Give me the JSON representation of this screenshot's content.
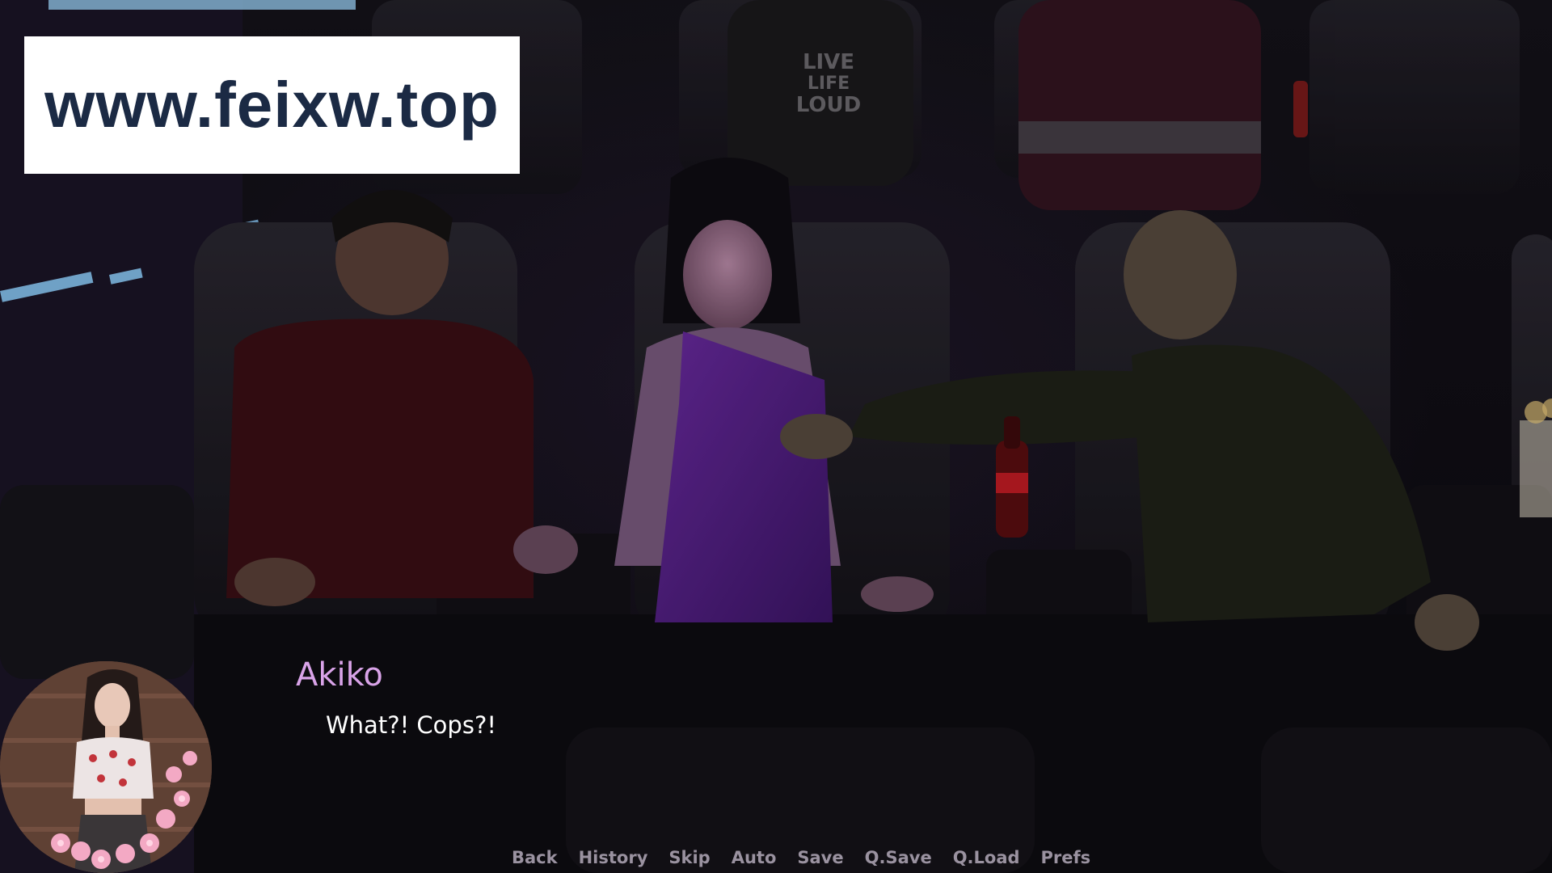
{
  "watermark": {
    "text": "www.feixw.top"
  },
  "dialogue": {
    "speaker": "Akiko",
    "text": "What?! Cops?!",
    "speaker_color": "#d9a3e8"
  },
  "quick_menu": {
    "items": [
      {
        "label": "Back"
      },
      {
        "label": "History"
      },
      {
        "label": "Skip"
      },
      {
        "label": "Auto"
      },
      {
        "label": "Save"
      },
      {
        "label": "Q.Save"
      },
      {
        "label": "Q.Load"
      },
      {
        "label": "Prefs"
      }
    ]
  },
  "scene": {
    "shirt_text": "LIVE LIFE LOUD"
  }
}
